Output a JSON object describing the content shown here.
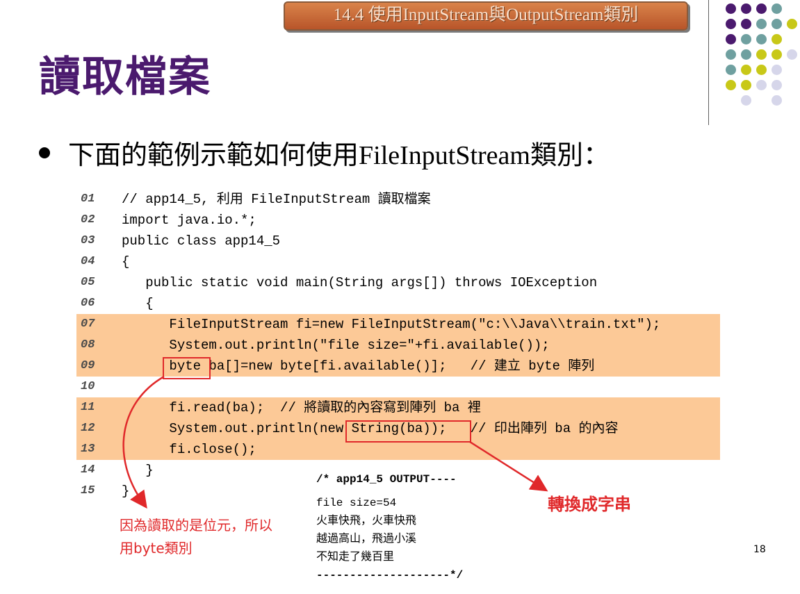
{
  "banner": {
    "text": "14.4 使用InputStream與OutputStream類別"
  },
  "title": "讀取檔案",
  "bullet": "下面的範例示範如何使用FileInputStream類別：",
  "code_lines": [
    {
      "num": "01",
      "code": "// app14_5, 利用 FileInputStream 讀取檔案",
      "highlight": false
    },
    {
      "num": "02",
      "code": "import java.io.*;",
      "highlight": false
    },
    {
      "num": "03",
      "code": "public class app14_5",
      "highlight": false
    },
    {
      "num": "04",
      "code": "{",
      "highlight": false
    },
    {
      "num": "05",
      "code": "   public static void main(String args[]) throws IOException",
      "highlight": false
    },
    {
      "num": "06",
      "code": "   {",
      "highlight": false
    },
    {
      "num": "07",
      "code": "      FileInputStream fi=new FileInputStream(\"c:\\\\Java\\\\train.txt\");",
      "highlight": true
    },
    {
      "num": "08",
      "code": "      System.out.println(\"file size=\"+fi.available());",
      "highlight": true
    },
    {
      "num": "09",
      "code": "      byte ba[]=new byte[fi.available()];   // 建立 byte 陣列",
      "highlight": true
    },
    {
      "num": "10",
      "code": "",
      "highlight": false
    },
    {
      "num": "11",
      "code": "      fi.read(ba);  // 將讀取的內容寫到陣列 ba 裡",
      "highlight": true
    },
    {
      "num": "12",
      "code": "      System.out.println(new String(ba));   // 印出陣列 ba 的內容",
      "highlight": true
    },
    {
      "num": "13",
      "code": "      fi.close();",
      "highlight": true
    },
    {
      "num": "14",
      "code": "   }",
      "highlight": false
    },
    {
      "num": "15",
      "code": "}",
      "highlight": false
    }
  ],
  "notes": {
    "byte_note_line1": "因為讀取的是位元，所以",
    "byte_note_line2": "用byte類別",
    "string_note": "轉換成字串"
  },
  "output": {
    "header": "/* app14_5 OUTPUT----",
    "lines": [
      "file size=54",
      "火車快飛，火車快飛",
      "越過高山，飛過小溪",
      "不知走了幾百里"
    ],
    "footer": "--------------------*/"
  },
  "page_number": "18",
  "colors": {
    "title": "#4b1a6e",
    "highlight": "#fcc997",
    "annotation_red": "#e0282a",
    "banner": "#c96a38",
    "dot_purple": "#4b1a6e",
    "dot_teal": "#6fa0a0",
    "dot_olive": "#c8c818",
    "dot_lavender": "#d6d6ea"
  }
}
